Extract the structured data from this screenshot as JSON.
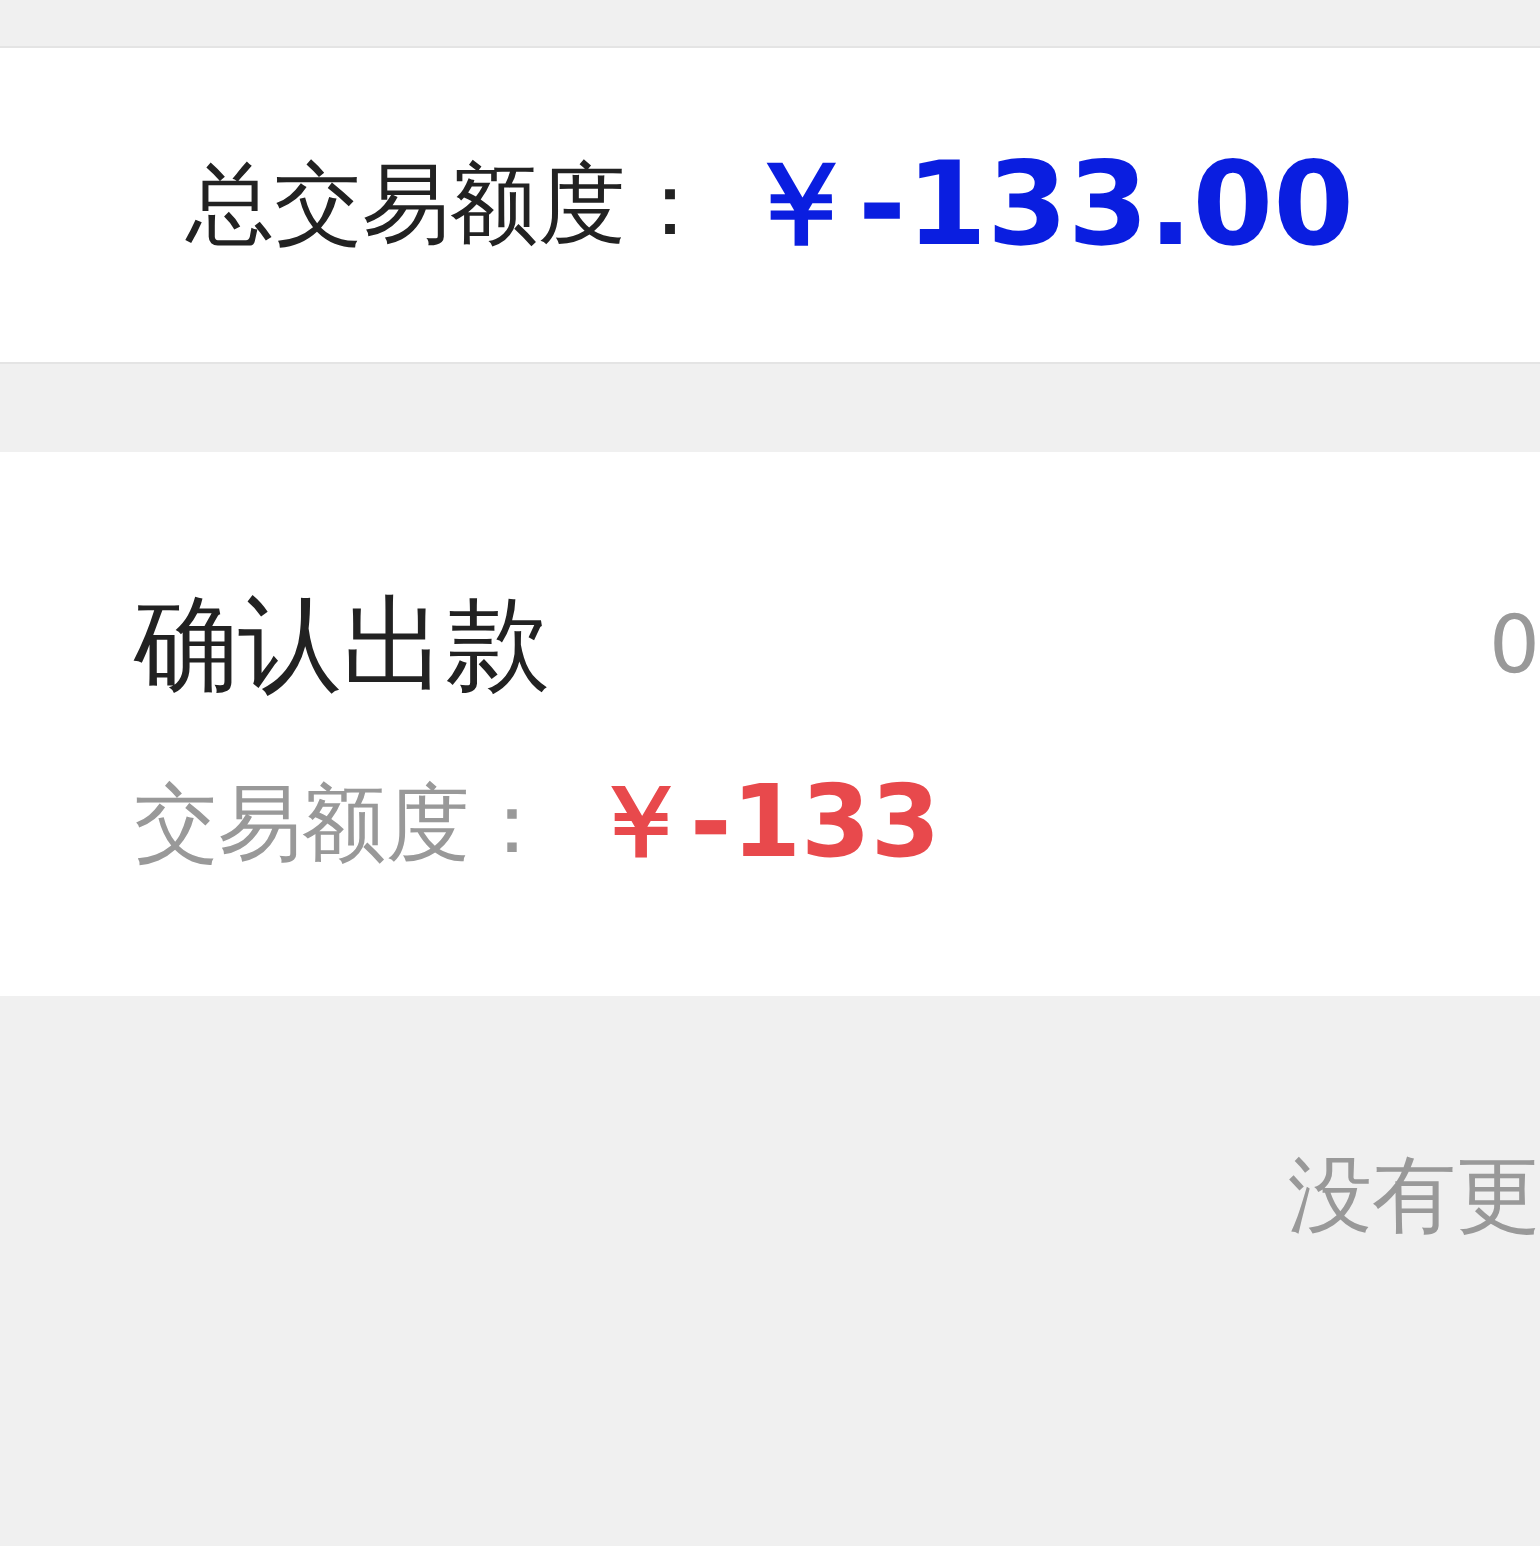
{
  "summary": {
    "label": "总交易额度：",
    "amount": "￥-133.00"
  },
  "records": [
    {
      "title": "确认出款",
      "time": "0",
      "amount_label": "交易额度：",
      "amount": "￥-133"
    }
  ],
  "footer": {
    "text": "没有更"
  }
}
